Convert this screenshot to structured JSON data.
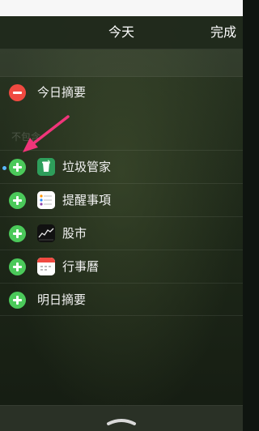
{
  "nav": {
    "title": "今天",
    "done_label": "完成"
  },
  "active_items": [
    {
      "label": "今日摘要",
      "action": "remove"
    }
  ],
  "section": {
    "header": "不包含"
  },
  "inactive_items": [
    {
      "label": "垃圾管家",
      "icon": "trash-manager-app-icon",
      "action": "add"
    },
    {
      "label": "提醒事項",
      "icon": "reminders-app-icon",
      "action": "add"
    },
    {
      "label": "股市",
      "icon": "stocks-app-icon",
      "action": "add"
    },
    {
      "label": "行事曆",
      "icon": "calendar-app-icon",
      "action": "add"
    },
    {
      "label": "明日摘要",
      "icon": "",
      "action": "add"
    }
  ],
  "colors": {
    "remove": "#f04a41",
    "add": "#4bc95a",
    "annotation_arrow": "#f0357a"
  }
}
